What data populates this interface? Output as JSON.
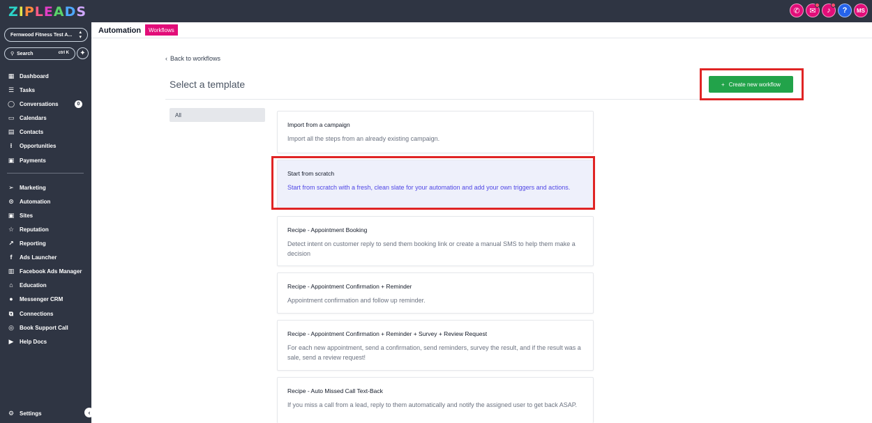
{
  "brand": {
    "logo_letters": [
      "Z",
      "I",
      "P",
      "L",
      "E",
      "A",
      "D",
      "S"
    ],
    "logo_colors": [
      "#2bd4c9",
      "#e2e34b",
      "#ff8a3d",
      "#ff5a8a",
      "#e23ec7",
      "#5bd36a",
      "#4fa8ff",
      "#d0a8ff"
    ]
  },
  "topbar": {
    "icons": [
      {
        "name": "phone-icon",
        "glyph": "✆",
        "bg": "#e20d79",
        "dot": false
      },
      {
        "name": "megaphone-icon",
        "glyph": "📢",
        "bg": "#e20d79",
        "dot": true
      },
      {
        "name": "bell-icon",
        "glyph": "🔔",
        "bg": "#e20d79",
        "dot": true
      },
      {
        "name": "help-icon",
        "glyph": "?",
        "bg": "#2563eb",
        "dot": false
      },
      {
        "name": "avatar",
        "glyph": "MS",
        "bg": "#e20d79",
        "dot": false
      }
    ]
  },
  "sidebar": {
    "location": "Fernwood Fitness Test A...",
    "search_label": "Search",
    "search_shortcut": "ctrl K",
    "items": [
      {
        "id": "dashboard",
        "label": "Dashboard",
        "icon": "dashboard-icon",
        "glyph": "▦"
      },
      {
        "id": "tasks",
        "label": "Tasks",
        "icon": "tasks-icon",
        "glyph": "☰"
      },
      {
        "id": "conversations",
        "label": "Conversations",
        "icon": "chat-icon",
        "glyph": "◯",
        "badge": "0"
      },
      {
        "id": "calendars",
        "label": "Calendars",
        "icon": "calendar-icon",
        "glyph": "▭"
      },
      {
        "id": "contacts",
        "label": "Contacts",
        "icon": "contacts-icon",
        "glyph": "▤"
      },
      {
        "id": "opportunities",
        "label": "Opportunities",
        "icon": "opportunities-icon",
        "glyph": "⁝"
      },
      {
        "id": "payments",
        "label": "Payments",
        "icon": "payments-icon",
        "glyph": "▣"
      }
    ],
    "items2": [
      {
        "id": "marketing",
        "label": "Marketing",
        "icon": "send-icon",
        "glyph": "➢"
      },
      {
        "id": "automation",
        "label": "Automation",
        "icon": "automation-icon",
        "glyph": "⊙"
      },
      {
        "id": "sites",
        "label": "Sites",
        "icon": "sites-icon",
        "glyph": "▣"
      },
      {
        "id": "reputation",
        "label": "Reputation",
        "icon": "star-icon",
        "glyph": "☆"
      },
      {
        "id": "reporting",
        "label": "Reporting",
        "icon": "trend-icon",
        "glyph": "↗"
      },
      {
        "id": "ads-launcher",
        "label": "Ads Launcher",
        "icon": "facebook-icon",
        "glyph": "f"
      },
      {
        "id": "facebook-ads-manager",
        "label": "Facebook Ads Manager",
        "icon": "chart-icon",
        "glyph": "▥"
      },
      {
        "id": "education",
        "label": "Education",
        "icon": "graduation-cap-icon",
        "glyph": "⌂"
      },
      {
        "id": "messenger-crm",
        "label": "Messenger CRM",
        "icon": "messenger-icon",
        "glyph": "●"
      },
      {
        "id": "connections",
        "label": "Connections",
        "icon": "network-icon",
        "glyph": "⧉"
      },
      {
        "id": "book-support-call",
        "label": "Book Support Call",
        "icon": "support-icon",
        "glyph": "◎"
      },
      {
        "id": "help-docs",
        "label": "Help Docs",
        "icon": "play-icon",
        "glyph": "▶"
      }
    ],
    "settings_label": "Settings"
  },
  "header": {
    "section": "Automation",
    "active_tab": "Workflows"
  },
  "main": {
    "back_link": "Back to workflows",
    "title": "Select a template",
    "create_button": "Create new workflow",
    "filter_all": "All",
    "templates": [
      {
        "title": "Import from a campaign",
        "desc": "Import all the steps from an already existing campaign.",
        "selected": false
      },
      {
        "title": "Start from scratch",
        "desc": "Start from scratch with a fresh, clean slate for your automation and add your own triggers and actions.",
        "selected": true
      },
      {
        "title": "Recipe - Appointment Booking",
        "desc": "Detect intent on customer reply to send them booking link or create a manual SMS to help them make a decision",
        "selected": false
      },
      {
        "title": "Recipe - Appointment Confirmation + Reminder",
        "desc": "Appointment confirmation and follow up reminder.",
        "selected": false
      },
      {
        "title": "Recipe - Appointment Confirmation + Reminder + Survey + Review Request",
        "desc": "For each new appointment, send a confirmation, send reminders, survey the result, and if the result was a sale, send a review request!",
        "selected": false
      },
      {
        "title": "Recipe - Auto Missed Call Text-Back",
        "desc": "If you miss a call from a lead, reply to them automatically and notify the assigned user to get back ASAP.",
        "selected": false
      }
    ]
  },
  "colors": {
    "sidebar_bg": "#2f3543",
    "accent_pink": "#e20d79",
    "create_green": "#22a34a",
    "highlight_red": "#e02424",
    "selected_card_bg": "#eef0fb"
  }
}
